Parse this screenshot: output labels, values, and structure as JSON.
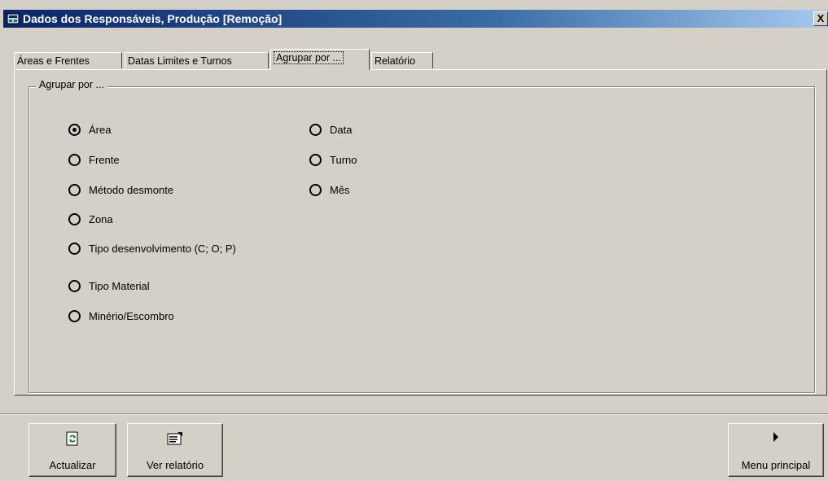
{
  "window": {
    "title": "Dados dos Responsáveis, Produção [Remoção]",
    "close_label": "X"
  },
  "tabs": [
    {
      "label": "Áreas e Frentes",
      "active": false
    },
    {
      "label": "Datas Limites e Turnos",
      "active": false
    },
    {
      "label": "Agrupar por ...",
      "active": true
    },
    {
      "label": "Relatório",
      "active": false
    }
  ],
  "group": {
    "label": "Agrupar por ...",
    "options_left": [
      {
        "label": "Área",
        "checked": true
      },
      {
        "label": "Frente",
        "checked": false
      },
      {
        "label": "Método desmonte",
        "checked": false
      },
      {
        "label": "Zona",
        "checked": false
      },
      {
        "label": "Tipo desenvolvimento (C; O; P)",
        "checked": false
      },
      {
        "label": "Tipo Material",
        "checked": false
      },
      {
        "label": "Minério/Escombro",
        "checked": false
      }
    ],
    "options_right": [
      {
        "label": "Data",
        "checked": false
      },
      {
        "label": "Turno",
        "checked": false
      },
      {
        "label": "Mês",
        "checked": false
      }
    ]
  },
  "buttons": {
    "refresh_label": "Actualizar",
    "report_label": "Ver relatório",
    "main_menu_label": "Menu principal"
  }
}
